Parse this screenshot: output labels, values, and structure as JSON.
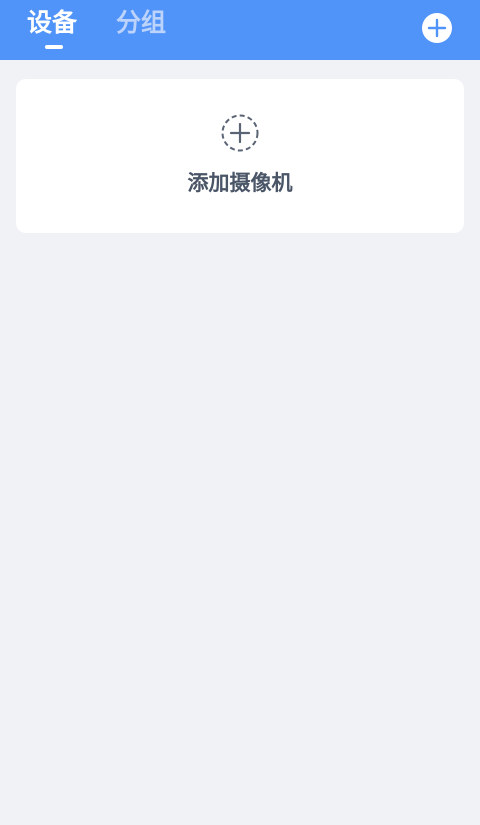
{
  "header": {
    "tabs": [
      {
        "label": "设备",
        "active": true
      },
      {
        "label": "分组",
        "active": false
      }
    ],
    "add_icon": "plus-circle-icon"
  },
  "main": {
    "add_camera_card": {
      "icon": "dashed-plus-circle-icon",
      "label": "添加摄像机"
    }
  },
  "colors": {
    "header_bg": "#5094f9",
    "page_bg": "#f0f2f6",
    "card_bg": "#ffffff",
    "active_tab": "#ffffff",
    "inactive_tab": "#bcd3fc",
    "card_text": "#4a5567"
  }
}
